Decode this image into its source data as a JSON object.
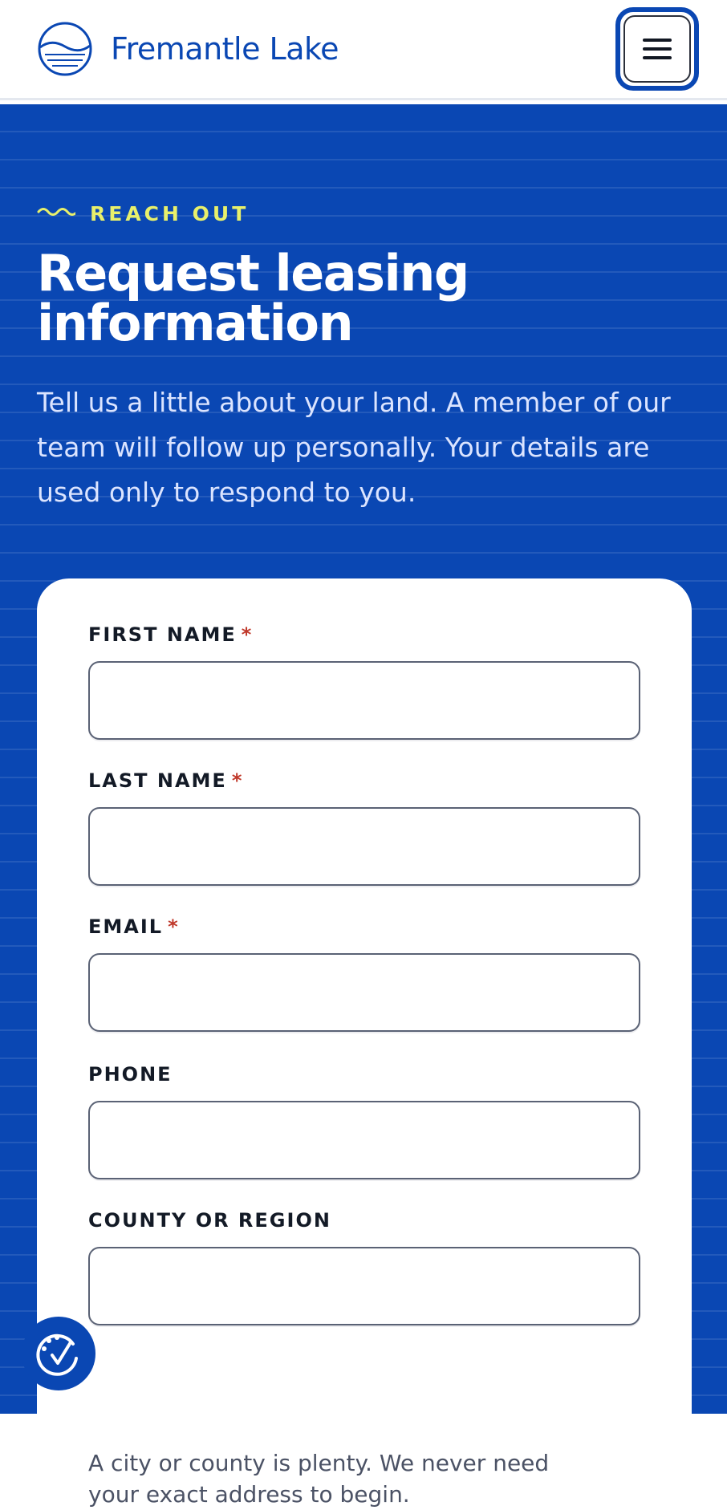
{
  "header": {
    "brand_name": "Fremantle Lake",
    "logo_icon": "lake-logo-icon",
    "menu_icon": "hamburger-menu-icon"
  },
  "hero": {
    "eyebrow": "REACH OUT",
    "title": "Request leasing information",
    "intro": "Tell us a little about your land. A member of our team will follow up personally. Your details are used only to respond to you."
  },
  "form": {
    "fields": [
      {
        "label": "FIRST NAME",
        "required": "*",
        "value": ""
      },
      {
        "label": "LAST NAME",
        "required": "*",
        "value": ""
      },
      {
        "label": "EMAIL",
        "required": "*",
        "value": ""
      },
      {
        "label": "PHONE",
        "value": ""
      },
      {
        "label": "COUNTY OR REGION",
        "value": ""
      }
    ],
    "region_hint": "A city or county is plenty. We never need your exact address to begin."
  },
  "accessibility": {
    "icon": "accessibility-icon"
  },
  "colors": {
    "brand_blue": "#0a47b3",
    "accent_yellow": "#e8f06b",
    "required_red": "#c0392b"
  }
}
